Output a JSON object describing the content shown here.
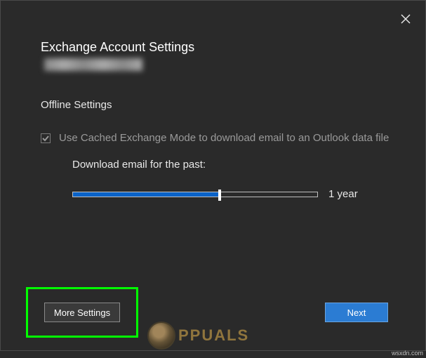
{
  "dialog": {
    "title": "Exchange Account Settings",
    "section_title": "Offline Settings",
    "checkbox_label": "Use Cached Exchange Mode to download email to an Outlook data file",
    "checkbox_checked": true,
    "slider": {
      "label": "Download email for the past:",
      "value_label": "1 year",
      "fill_percent": 60
    },
    "buttons": {
      "more_settings": "More Settings",
      "next": "Next"
    }
  },
  "watermark": {
    "brand": "PPUALS",
    "site": "wsxdn.com"
  }
}
